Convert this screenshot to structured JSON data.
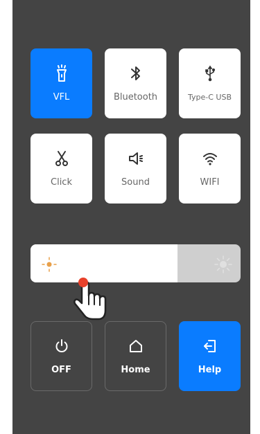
{
  "tiles": {
    "vfl": {
      "label": "VFL"
    },
    "bluetooth": {
      "label": "Bluetooth"
    },
    "usb": {
      "label": "Type-C USB"
    },
    "click": {
      "label": "Click"
    },
    "sound": {
      "label": "Sound"
    },
    "wifi": {
      "label": "WIFI"
    }
  },
  "brightness": {
    "level": 0.7
  },
  "bottom": {
    "off": {
      "label": "OFF"
    },
    "home": {
      "label": "Home"
    },
    "help": {
      "label": "Help"
    }
  },
  "colors": {
    "accent": "#0a7cff",
    "panel": "#444444"
  },
  "icons": [
    "flashlight-icon",
    "bluetooth-icon",
    "usb-icon",
    "scissors-icon",
    "speaker-icon",
    "wifi-icon",
    "sun-dim-icon",
    "sun-bright-icon",
    "power-icon",
    "home-icon",
    "exit-icon",
    "hand-pointer-icon"
  ]
}
